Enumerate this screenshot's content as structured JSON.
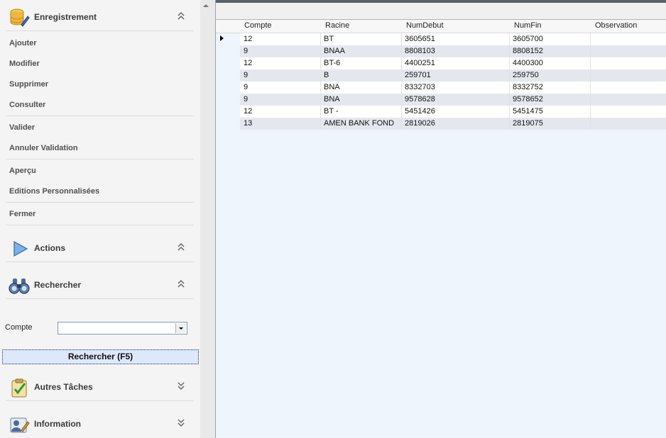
{
  "sidebar": {
    "enregistrement": {
      "title": "Enregistrement",
      "items": [
        "Ajouter",
        "Modifier",
        "Supprimer",
        "Consulter",
        "Valider",
        "Annuler Validation",
        "Aperçu",
        "Editions Personnalisées",
        "Fermer"
      ]
    },
    "actions": {
      "title": "Actions"
    },
    "rechercher": {
      "title": "Rechercher",
      "compte_label": "Compte",
      "compte_value": "",
      "button_label": "Rechercher (F5)"
    },
    "autres_taches": {
      "title": "Autres Tâches"
    },
    "information": {
      "title": "Information"
    }
  },
  "grid": {
    "columns": [
      "Compte",
      "Racine",
      "NumDebut",
      "NumFin",
      "Observation"
    ],
    "rows": [
      {
        "compte": "12",
        "racine": "BT",
        "numdebut": "3605651",
        "numfin": "3605700",
        "observation": ""
      },
      {
        "compte": "9",
        "racine": "BNAA",
        "numdebut": "8808103",
        "numfin": "8808152",
        "observation": ""
      },
      {
        "compte": "12",
        "racine": "BT-6",
        "numdebut": "4400251",
        "numfin": "4400300",
        "observation": ""
      },
      {
        "compte": "9",
        "racine": "B",
        "numdebut": "259701",
        "numfin": "259750",
        "observation": ""
      },
      {
        "compte": "9",
        "racine": "BNA",
        "numdebut": "8332703",
        "numfin": "8332752",
        "observation": ""
      },
      {
        "compte": "9",
        "racine": "BNA",
        "numdebut": "9578628",
        "numfin": "9578652",
        "observation": ""
      },
      {
        "compte": "12",
        "racine": "BT -",
        "numdebut": "5451426",
        "numfin": "5451475",
        "observation": ""
      },
      {
        "compte": "13",
        "racine": "AMEN BANK FOND",
        "numdebut": "2819026",
        "numfin": "2819075",
        "observation": ""
      }
    ]
  },
  "colors": {
    "grid_bg": "#eef5fc",
    "alt_row": "#e4e8ee",
    "button_bg": "#dde8fb"
  }
}
